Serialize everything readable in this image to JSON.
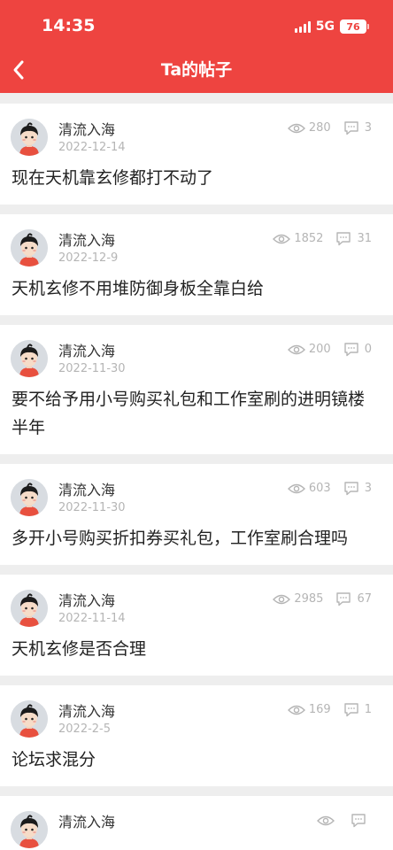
{
  "status_bar": {
    "time": "14:35",
    "network": "5G",
    "battery": "76"
  },
  "header": {
    "title": "Ta的帖子"
  },
  "posts": [
    {
      "author": "清流入海",
      "date": "2022-12-14",
      "views": "280",
      "comments": "3",
      "content": "现在天机靠玄修都打不动了"
    },
    {
      "author": "清流入海",
      "date": "2022-12-9",
      "views": "1852",
      "comments": "31",
      "content": "天机玄修不用堆防御身板全靠白给"
    },
    {
      "author": "清流入海",
      "date": "2022-11-30",
      "views": "200",
      "comments": "0",
      "content": "要不给予用小号购买礼包和工作室刷的进明镜楼半年"
    },
    {
      "author": "清流入海",
      "date": "2022-11-30",
      "views": "603",
      "comments": "3",
      "content": "多开小号购买折扣券买礼包，工作室刷合理吗"
    },
    {
      "author": "清流入海",
      "date": "2022-11-14",
      "views": "2985",
      "comments": "67",
      "content": "天机玄修是否合理"
    },
    {
      "author": "清流入海",
      "date": "2022-2-5",
      "views": "169",
      "comments": "1",
      "content": "论坛求混分"
    },
    {
      "author": "清流入海",
      "date": "",
      "views": "",
      "comments": "",
      "content": ""
    }
  ]
}
